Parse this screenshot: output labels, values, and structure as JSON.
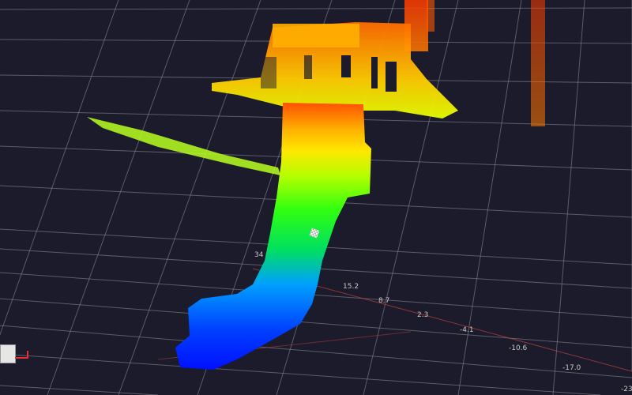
{
  "viewer": {
    "background": "#1b1b2b",
    "grid_color": "#8f8f9a",
    "colormap": [
      "#0018ff",
      "#00c8ff",
      "#00ff40",
      "#ffff00",
      "#ff7a00",
      "#ff3000"
    ]
  },
  "axis_labels": {
    "l1": "34",
    "l2": "15.2",
    "l3": "8.7",
    "l4": "2.3",
    "l5": "-4.1",
    "l6": "-10.6",
    "l7": "-17.0",
    "l8": "-23"
  },
  "icons": {
    "nav_cube": "axis-cube-icon",
    "selection_marker": "point-picker-icon"
  }
}
